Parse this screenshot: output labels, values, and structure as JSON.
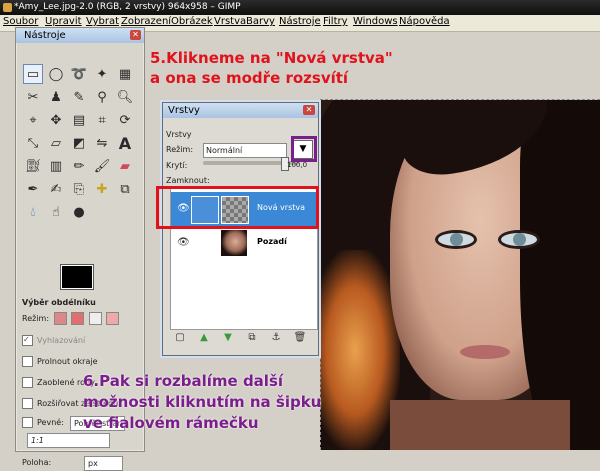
{
  "window": {
    "title": "*Amy_Lee.jpg-2.0 (RGB, 2 vrstvy) 964x958 – GIMP"
  },
  "menu": [
    "Soubor",
    "Upravit",
    "Vybrat",
    "Zobrazení",
    "Obrázek",
    "Vrstva",
    "Barvy",
    "Nástroje",
    "Filtry",
    "Windows",
    "Nápověda"
  ],
  "toolbox": {
    "title": "Nástroje",
    "tool_icons": [
      "rect-select-icon",
      "ellipse-select-icon",
      "lasso-icon",
      "fuzzy-select-icon",
      "select-by-color-icon",
      "scissors-icon",
      "foreground-select-icon",
      "paths-icon",
      "color-picker-icon",
      "zoom-icon",
      "measure-icon",
      "move-icon",
      "align-icon",
      "crop-icon",
      "rotate-icon",
      "scale-icon",
      "shear-icon",
      "perspective-icon",
      "flip-icon",
      "text-icon",
      "bucket-fill-icon",
      "blend-icon",
      "pencil-icon",
      "brush-icon",
      "eraser-icon",
      "airbrush-icon",
      "ink-icon",
      "clone-icon",
      "heal-icon",
      "perspective-clone-icon",
      "blur-icon",
      "smudge-icon",
      "dodge-burn-icon"
    ],
    "options": {
      "heading": "Výběr obdélníku",
      "mode_label": "Režim:",
      "antialias": "Vyhlazování",
      "feather": "Prolnout okraje",
      "rounded": "Zaoblené rohy",
      "expand": "Rozšiřovat ze středu",
      "fixed": "Pevné:",
      "fixed_value": "Poměr stran",
      "ratio": "1:1",
      "position": "Poloha:",
      "unit": "px"
    }
  },
  "layers": {
    "title": "Vrstvy",
    "tab_label": "Vrstvy",
    "mode_label": "Režim:",
    "mode_value": "Normální",
    "opacity_label": "Krytí:",
    "opacity_value": "100,0",
    "lock_label": "Zamknout:",
    "items": [
      {
        "name": "Nová vrstva",
        "active": true
      },
      {
        "name": "Pozadí",
        "active": false
      }
    ]
  },
  "annotations": {
    "step5_line1": "5.Klikneme na \"Nová vrstva\"",
    "step5_line2": "a ona se modře rozsvítí",
    "step6_line1": "6.Pak si rozbalíme další",
    "step6_line2": "možnosti kliknutím na šipku",
    "step6_line3": "ve fialovém rámečku"
  },
  "colors": {
    "annotation_red": "#e0121b",
    "annotation_purple": "#7a1e8c",
    "selection_blue": "#3b88d6"
  }
}
